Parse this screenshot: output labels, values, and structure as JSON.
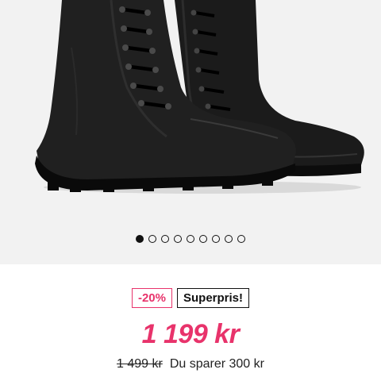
{
  "gallery": {
    "image_icon": "black-leather-lace-up-boots",
    "dot_count": 9,
    "active_dot": 0
  },
  "price_panel": {
    "discount_badge": "-20%",
    "superpris_badge": "Superpris!",
    "current_price": "1 199 kr",
    "old_price": "1 499 kr",
    "savings_text": "Du sparer 300 kr"
  },
  "colors": {
    "accent": "#e8336b",
    "text": "#111111",
    "gallery_bg": "#f2f2f2"
  }
}
